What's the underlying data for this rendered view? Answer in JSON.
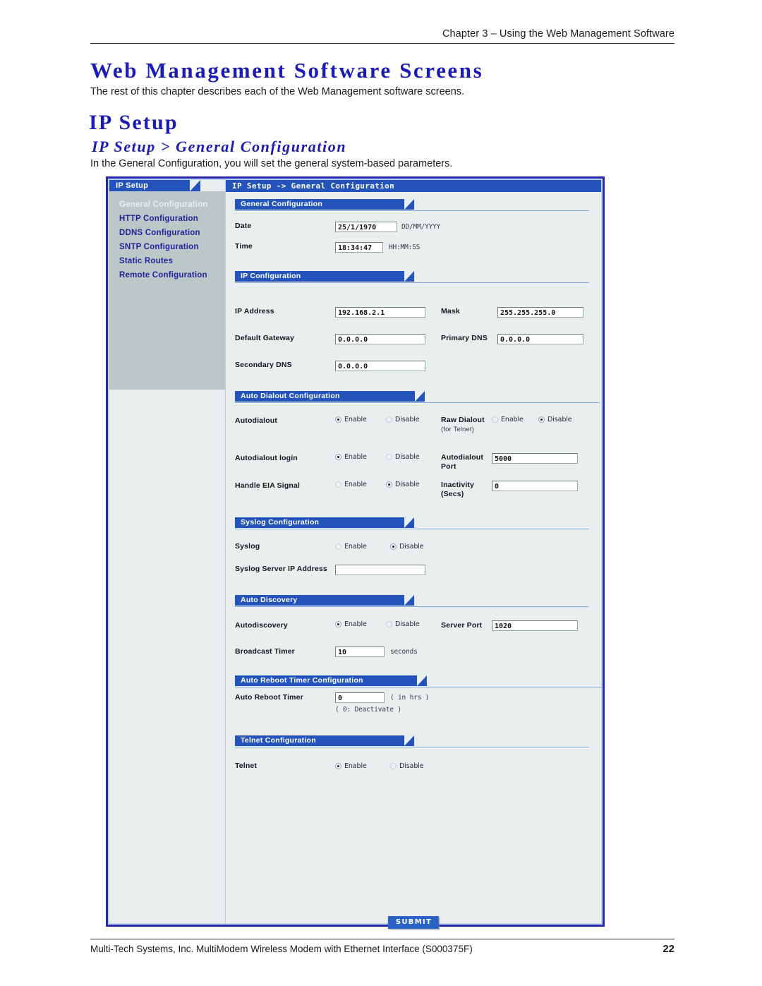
{
  "document": {
    "header_text": "Chapter 3 – Using the Web Management Software",
    "h1": "Web Management Software Screens",
    "intro": "The rest of this chapter describes each of the Web Management software screens.",
    "h2": "IP Setup",
    "h3": "IP Setup > General Configuration",
    "section_description": "In the General Configuration, you will set the general system-based parameters.",
    "footer_text": "Multi-Tech Systems, Inc. MultiModem Wireless Modem with Ethernet Interface (S000375F)",
    "page_number": "22"
  },
  "app": {
    "sidebar": {
      "title": "IP Setup",
      "items": [
        {
          "label": "General Configuration",
          "active": true
        },
        {
          "label": "HTTP Configuration",
          "active": false
        },
        {
          "label": "DDNS Configuration",
          "active": false
        },
        {
          "label": "SNTP Configuration",
          "active": false
        },
        {
          "label": "Static Routes",
          "active": false
        },
        {
          "label": "Remote Configuration",
          "active": false
        }
      ]
    },
    "breadcrumb": "IP Setup -> General Configuration",
    "sections": {
      "general": {
        "title": "General Configuration",
        "date_label": "Date",
        "date_value": "25/1/1970",
        "date_hint": "DD/MM/YYYY",
        "time_label": "Time",
        "time_value": "18:34:47",
        "time_hint": "HH:MM:SS"
      },
      "ip": {
        "title": "IP Configuration",
        "ip_address_label": "IP Address",
        "ip_address_value": "192.168.2.1",
        "mask_label": "Mask",
        "mask_value": "255.255.255.0",
        "default_gateway_label": "Default Gateway",
        "default_gateway_value": "0.0.0.0",
        "primary_dns_label": "Primary DNS",
        "primary_dns_value": "0.0.0.0",
        "secondary_dns_label": "Secondary DNS",
        "secondary_dns_value": "0.0.0.0"
      },
      "autodialout": {
        "title": "Auto Dialout Configuration",
        "autodialout_label": "Autodialout",
        "autodialout_selected": "Enable",
        "raw_dialout_label_1": "Raw Dialout",
        "raw_dialout_label_2": "(for Telnet)",
        "raw_dialout_selected": "Disable",
        "autodialout_login_label": "Autodialout login",
        "autodialout_login_selected": "Enable",
        "autodialout_port_label_1": "Autodialout",
        "autodialout_port_label_2": "Port",
        "autodialout_port_value": "5000",
        "handle_eia_label": "Handle EIA Signal",
        "handle_eia_selected": "Disable",
        "inactivity_label_1": "Inactivity",
        "inactivity_label_2": "(Secs)",
        "inactivity_value": "0"
      },
      "syslog": {
        "title": "Syslog Configuration",
        "syslog_label": "Syslog",
        "syslog_selected": "Disable",
        "server_ip_label": "Syslog Server IP Address",
        "server_ip_value": ""
      },
      "discovery": {
        "title": "Auto Discovery",
        "autodiscovery_label": "Autodiscovery",
        "autodiscovery_selected": "Enable",
        "server_port_label": "Server Port",
        "server_port_value": "1020",
        "broadcast_timer_label": "Broadcast Timer",
        "broadcast_timer_value": "10",
        "broadcast_timer_unit": "seconds"
      },
      "reboot": {
        "title": "Auto Reboot Timer Configuration",
        "timer_label": "Auto Reboot Timer",
        "timer_value": "0",
        "timer_hint": "( in hrs )",
        "timer_note": "( 0: Deactivate )"
      },
      "telnet": {
        "title": "Telnet Configuration",
        "telnet_label": "Telnet",
        "telnet_selected": "Enable"
      }
    },
    "radio_labels": {
      "enable": "Enable",
      "disable": "Disable"
    },
    "submit_label": "SUBMIT"
  },
  "colors": {
    "accent_blue": "#2454bb",
    "heading_blue": "#1b1bb5",
    "panel_gray": "#bcc8c8",
    "page_bg": "#e9eeee",
    "frame_border": "#2727b0"
  }
}
